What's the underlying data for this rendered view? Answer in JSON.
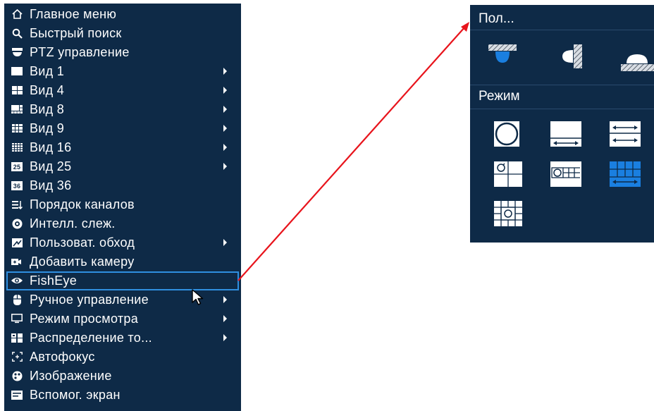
{
  "menu": {
    "items": [
      {
        "label": "Главное меню",
        "icon": "home-icon",
        "submenu": false
      },
      {
        "label": "Быстрый поиск",
        "icon": "search-icon",
        "submenu": false
      },
      {
        "label": "PTZ управление",
        "icon": "ptz-icon",
        "submenu": false
      },
      {
        "label": "Вид 1",
        "icon": "view-1-icon",
        "submenu": true
      },
      {
        "label": "Вид 4",
        "icon": "view-4-icon",
        "submenu": true
      },
      {
        "label": "Вид 8",
        "icon": "view-8-icon",
        "submenu": true
      },
      {
        "label": "Вид 9",
        "icon": "view-9-icon",
        "submenu": true
      },
      {
        "label": "Вид 16",
        "icon": "view-16-icon",
        "submenu": true
      },
      {
        "label": "Вид 25",
        "icon": "view-25-icon",
        "badge": "25",
        "submenu": true
      },
      {
        "label": "Вид 36",
        "icon": "view-36-icon",
        "badge": "36",
        "submenu": false
      },
      {
        "label": "Порядок каналов",
        "icon": "channel-order-icon",
        "submenu": false
      },
      {
        "label": "Интелл. слеж.",
        "icon": "smart-track-icon",
        "submenu": false
      },
      {
        "label": "Пользоват. обход",
        "icon": "custom-tour-icon",
        "submenu": true
      },
      {
        "label": "Добавить камеру",
        "icon": "add-camera-icon",
        "submenu": false
      },
      {
        "label": "FishEye",
        "icon": "fisheye-icon",
        "submenu": false,
        "selected": true
      },
      {
        "label": "Ручное управление",
        "icon": "manual-control-icon",
        "submenu": true
      },
      {
        "label": "Режим просмотра",
        "icon": "view-mode-icon",
        "submenu": true
      },
      {
        "label": "Распределение то...",
        "icon": "stream-distribution-icon",
        "submenu": true
      },
      {
        "label": "Автофокус",
        "icon": "autofocus-icon",
        "submenu": false
      },
      {
        "label": "Изображение",
        "icon": "image-icon",
        "submenu": false
      },
      {
        "label": "Вспомог. экран",
        "icon": "aux-screen-icon",
        "submenu": false
      }
    ]
  },
  "panel": {
    "title": "Пол...",
    "mode_label": "Режим",
    "mount_icons": [
      "ceiling-mount-icon",
      "wall-mount-icon",
      "ground-mount-icon"
    ],
    "mode_icons": [
      "fisheye-original-icon",
      "panorama-180-icon",
      "panorama-360-icon",
      "fisheye-plus-3-icon",
      "fisheye-plus-4-icon",
      "panorama-plus-8-icon",
      "fisheye-plus-8-icon"
    ],
    "active_mode": "panorama-plus-8-icon"
  },
  "colors": {
    "menu_bg": "#0e2a47",
    "selection_border": "#2f8fe0",
    "active_mode": "#1a7fe0",
    "arrow": "#e8141c"
  }
}
